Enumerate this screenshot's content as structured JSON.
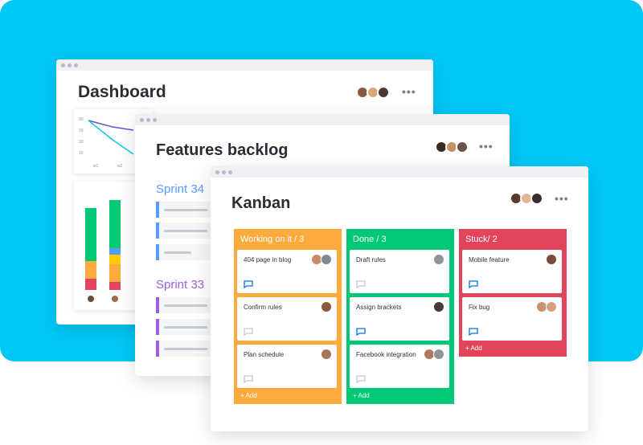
{
  "windows": {
    "dashboard": {
      "title": "Dashboard"
    },
    "features": {
      "title": "Features backlog"
    },
    "kanban": {
      "title": "Kanban"
    }
  },
  "dashboard_chart": {
    "y_ticks": [
      "30",
      "20",
      "20",
      "10"
    ],
    "x_ticks": [
      "w1",
      "w2"
    ]
  },
  "sprints": [
    {
      "label": "Sprint 34",
      "color": "#579bfc",
      "rows": 3
    },
    {
      "label": "Sprint 33",
      "color": "#a25ddc",
      "rows": 3
    }
  ],
  "kanban": {
    "columns": [
      {
        "title": "Working on it / 3",
        "color": "#fdab3d",
        "add_label": "+ Add",
        "cards": [
          {
            "title": "404 page in blog",
            "comment_active": true
          },
          {
            "title": "Confirm rules",
            "comment_active": false
          },
          {
            "title": "Plan schedule",
            "comment_active": false
          }
        ]
      },
      {
        "title": "Done / 3",
        "color": "#00c875",
        "add_label": "+ Add",
        "cards": [
          {
            "title": "Draft rules",
            "comment_active": false
          },
          {
            "title": "Assign brackets",
            "comment_active": true
          },
          {
            "title": "Facebook integration",
            "comment_active": false
          }
        ]
      },
      {
        "title": "Stuck/ 2",
        "color": "#e2445c",
        "add_label": "+ Add",
        "cards": [
          {
            "title": "Mobile feature",
            "comment_active": true
          },
          {
            "title": "Fix bug",
            "comment_active": true
          }
        ]
      }
    ]
  },
  "colors": {
    "accent_blue": "#00c8f6",
    "green": "#00c875",
    "orange": "#fdab3d",
    "red": "#e2445c",
    "blue": "#579bfc",
    "yellow": "#ffcb00",
    "purple": "#a25ddc"
  }
}
